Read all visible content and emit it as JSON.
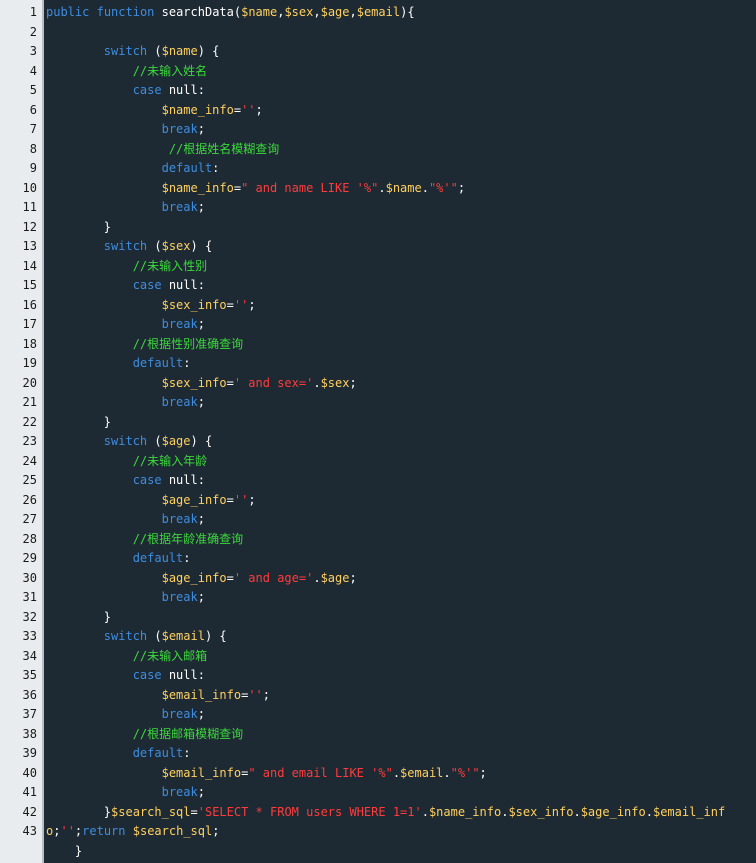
{
  "editor": {
    "line_numbers": [
      "1",
      "2",
      "3",
      "4",
      "5",
      "6",
      "7",
      "8",
      "9",
      "10",
      "11",
      "12",
      "13",
      "14",
      "15",
      "16",
      "17",
      "18",
      "19",
      "20",
      "21",
      "22",
      "23",
      "24",
      "25",
      "26",
      "27",
      "28",
      "29",
      "30",
      "31",
      "32",
      "33",
      "34",
      "35",
      "36",
      "37",
      "38",
      "39",
      "40",
      "41",
      "42",
      "43"
    ],
    "lines": [
      [
        {
          "k": "keyword",
          "t": "public"
        },
        {
          "k": "plain",
          "t": " "
        },
        {
          "k": "keyword",
          "t": "function"
        },
        {
          "k": "plain",
          "t": " searchData("
        },
        {
          "k": "var",
          "t": "$name"
        },
        {
          "k": "plain",
          "t": ","
        },
        {
          "k": "var",
          "t": "$sex"
        },
        {
          "k": "plain",
          "t": ","
        },
        {
          "k": "var",
          "t": "$age"
        },
        {
          "k": "plain",
          "t": ","
        },
        {
          "k": "var",
          "t": "$email"
        },
        {
          "k": "plain",
          "t": "){"
        }
      ],
      [],
      [
        {
          "k": "plain",
          "t": "        "
        },
        {
          "k": "keyword",
          "t": "switch"
        },
        {
          "k": "plain",
          "t": " ("
        },
        {
          "k": "var",
          "t": "$name"
        },
        {
          "k": "plain",
          "t": ") {"
        }
      ],
      [
        {
          "k": "plain",
          "t": "            "
        },
        {
          "k": "comment",
          "t": "//未输入姓名"
        }
      ],
      [
        {
          "k": "plain",
          "t": "            "
        },
        {
          "k": "keyword",
          "t": "case"
        },
        {
          "k": "plain",
          "t": " null:"
        }
      ],
      [
        {
          "k": "plain",
          "t": "                "
        },
        {
          "k": "var",
          "t": "$name_info"
        },
        {
          "k": "plain",
          "t": "="
        },
        {
          "k": "string",
          "t": "''"
        },
        {
          "k": "plain",
          "t": ";"
        }
      ],
      [
        {
          "k": "plain",
          "t": "                "
        },
        {
          "k": "keyword",
          "t": "break"
        },
        {
          "k": "plain",
          "t": ";"
        }
      ],
      [
        {
          "k": "plain",
          "t": "                 "
        },
        {
          "k": "comment",
          "t": "//根据姓名模糊查询"
        }
      ],
      [
        {
          "k": "plain",
          "t": "                "
        },
        {
          "k": "keyword",
          "t": "default"
        },
        {
          "k": "plain",
          "t": ":"
        }
      ],
      [
        {
          "k": "plain",
          "t": "                "
        },
        {
          "k": "var",
          "t": "$name_info"
        },
        {
          "k": "plain",
          "t": "="
        },
        {
          "k": "string",
          "t": "\" and name LIKE '%\""
        },
        {
          "k": "plain",
          "t": "."
        },
        {
          "k": "var",
          "t": "$name"
        },
        {
          "k": "plain",
          "t": "."
        },
        {
          "k": "string",
          "t": "\"%'\""
        },
        {
          "k": "plain",
          "t": ";"
        }
      ],
      [
        {
          "k": "plain",
          "t": "                "
        },
        {
          "k": "keyword",
          "t": "break"
        },
        {
          "k": "plain",
          "t": ";"
        }
      ],
      [
        {
          "k": "plain",
          "t": "        }"
        }
      ],
      [
        {
          "k": "plain",
          "t": "        "
        },
        {
          "k": "keyword",
          "t": "switch"
        },
        {
          "k": "plain",
          "t": " ("
        },
        {
          "k": "var",
          "t": "$sex"
        },
        {
          "k": "plain",
          "t": ") {"
        }
      ],
      [
        {
          "k": "plain",
          "t": "            "
        },
        {
          "k": "comment",
          "t": "//未输入性别"
        }
      ],
      [
        {
          "k": "plain",
          "t": "            "
        },
        {
          "k": "keyword",
          "t": "case"
        },
        {
          "k": "plain",
          "t": " null:"
        }
      ],
      [
        {
          "k": "plain",
          "t": "                "
        },
        {
          "k": "var",
          "t": "$sex_info"
        },
        {
          "k": "plain",
          "t": "="
        },
        {
          "k": "string",
          "t": "''"
        },
        {
          "k": "plain",
          "t": ";"
        }
      ],
      [
        {
          "k": "plain",
          "t": "                "
        },
        {
          "k": "keyword",
          "t": "break"
        },
        {
          "k": "plain",
          "t": ";"
        }
      ],
      [
        {
          "k": "plain",
          "t": "            "
        },
        {
          "k": "comment",
          "t": "//根据性别准确查询"
        }
      ],
      [
        {
          "k": "plain",
          "t": "            "
        },
        {
          "k": "keyword",
          "t": "default"
        },
        {
          "k": "plain",
          "t": ":"
        }
      ],
      [
        {
          "k": "plain",
          "t": "                "
        },
        {
          "k": "var",
          "t": "$sex_info"
        },
        {
          "k": "plain",
          "t": "="
        },
        {
          "k": "string",
          "t": "' and sex='"
        },
        {
          "k": "plain",
          "t": "."
        },
        {
          "k": "var",
          "t": "$sex"
        },
        {
          "k": "plain",
          "t": ";"
        }
      ],
      [
        {
          "k": "plain",
          "t": "                "
        },
        {
          "k": "keyword",
          "t": "break"
        },
        {
          "k": "plain",
          "t": ";"
        }
      ],
      [
        {
          "k": "plain",
          "t": "        }"
        }
      ],
      [
        {
          "k": "plain",
          "t": "        "
        },
        {
          "k": "keyword",
          "t": "switch"
        },
        {
          "k": "plain",
          "t": " ("
        },
        {
          "k": "var",
          "t": "$age"
        },
        {
          "k": "plain",
          "t": ") {"
        }
      ],
      [
        {
          "k": "plain",
          "t": "            "
        },
        {
          "k": "comment",
          "t": "//未输入年龄"
        }
      ],
      [
        {
          "k": "plain",
          "t": "            "
        },
        {
          "k": "keyword",
          "t": "case"
        },
        {
          "k": "plain",
          "t": " null:"
        }
      ],
      [
        {
          "k": "plain",
          "t": "                "
        },
        {
          "k": "var",
          "t": "$age_info"
        },
        {
          "k": "plain",
          "t": "="
        },
        {
          "k": "string",
          "t": "''"
        },
        {
          "k": "plain",
          "t": ";"
        }
      ],
      [
        {
          "k": "plain",
          "t": "                "
        },
        {
          "k": "keyword",
          "t": "break"
        },
        {
          "k": "plain",
          "t": ";"
        }
      ],
      [
        {
          "k": "plain",
          "t": "            "
        },
        {
          "k": "comment",
          "t": "//根据年龄准确查询"
        }
      ],
      [
        {
          "k": "plain",
          "t": "            "
        },
        {
          "k": "keyword",
          "t": "default"
        },
        {
          "k": "plain",
          "t": ":"
        }
      ],
      [
        {
          "k": "plain",
          "t": "                "
        },
        {
          "k": "var",
          "t": "$age_info"
        },
        {
          "k": "plain",
          "t": "="
        },
        {
          "k": "string",
          "t": "' and age='"
        },
        {
          "k": "plain",
          "t": "."
        },
        {
          "k": "var",
          "t": "$age"
        },
        {
          "k": "plain",
          "t": ";"
        }
      ],
      [
        {
          "k": "plain",
          "t": "                "
        },
        {
          "k": "keyword",
          "t": "break"
        },
        {
          "k": "plain",
          "t": ";"
        }
      ],
      [
        {
          "k": "plain",
          "t": "        }"
        }
      ],
      [
        {
          "k": "plain",
          "t": "        "
        },
        {
          "k": "keyword",
          "t": "switch"
        },
        {
          "k": "plain",
          "t": " ("
        },
        {
          "k": "var",
          "t": "$email"
        },
        {
          "k": "plain",
          "t": ") {"
        }
      ],
      [
        {
          "k": "plain",
          "t": "            "
        },
        {
          "k": "comment",
          "t": "//未输入邮箱"
        }
      ],
      [
        {
          "k": "plain",
          "t": "            "
        },
        {
          "k": "keyword",
          "t": "case"
        },
        {
          "k": "plain",
          "t": " null:"
        }
      ],
      [
        {
          "k": "plain",
          "t": "                "
        },
        {
          "k": "var",
          "t": "$email_info"
        },
        {
          "k": "plain",
          "t": "="
        },
        {
          "k": "string",
          "t": "''"
        },
        {
          "k": "plain",
          "t": ";"
        }
      ],
      [
        {
          "k": "plain",
          "t": "                "
        },
        {
          "k": "keyword",
          "t": "break"
        },
        {
          "k": "plain",
          "t": ";"
        }
      ],
      [
        {
          "k": "plain",
          "t": "            "
        },
        {
          "k": "comment",
          "t": "//根据邮箱模糊查询"
        }
      ],
      [
        {
          "k": "plain",
          "t": "            "
        },
        {
          "k": "keyword",
          "t": "default"
        },
        {
          "k": "plain",
          "t": ":"
        }
      ],
      [
        {
          "k": "plain",
          "t": "                "
        },
        {
          "k": "var",
          "t": "$email_info"
        },
        {
          "k": "plain",
          "t": "="
        },
        {
          "k": "string",
          "t": "\" and email LIKE '%\""
        },
        {
          "k": "plain",
          "t": "."
        },
        {
          "k": "var",
          "t": "$email"
        },
        {
          "k": "plain",
          "t": "."
        },
        {
          "k": "string",
          "t": "\"%'\""
        },
        {
          "k": "plain",
          "t": ";"
        }
      ],
      [
        {
          "k": "plain",
          "t": "                "
        },
        {
          "k": "keyword",
          "t": "break"
        },
        {
          "k": "plain",
          "t": ";"
        }
      ],
      [
        {
          "k": "plain",
          "t": "        }"
        },
        {
          "k": "var",
          "t": "$search_sql"
        },
        {
          "k": "plain",
          "t": "="
        },
        {
          "k": "string",
          "t": "'SELECT * FROM users WHERE 1=1'"
        },
        {
          "k": "plain",
          "t": "."
        },
        {
          "k": "var",
          "t": "$name_info"
        },
        {
          "k": "plain",
          "t": "."
        },
        {
          "k": "var",
          "t": "$sex_info"
        },
        {
          "k": "plain",
          "t": "."
        },
        {
          "k": "var",
          "t": "$age_info"
        },
        {
          "k": "plain",
          "t": "."
        },
        {
          "k": "var",
          "t": "$email_inf"
        }
      ],
      [
        {
          "k": "var",
          "t": "o"
        },
        {
          "k": "plain",
          "t": ";"
        },
        {
          "k": "string",
          "t": "''"
        },
        {
          "k": "plain",
          "t": ";"
        },
        {
          "k": "keyword",
          "t": "return"
        },
        {
          "k": "plain",
          "t": " "
        },
        {
          "k": "var",
          "t": "$search_sql"
        },
        {
          "k": "plain",
          "t": ";"
        }
      ],
      [
        {
          "k": "plain",
          "t": "    }"
        }
      ]
    ]
  },
  "colors": {
    "background": "#1e2a33",
    "gutter": "#e9ecee",
    "keyword": "#3d8de0",
    "variable": "#ffd060",
    "string": "#ff3b3b",
    "comment": "#3cd83c",
    "plain": "#ffffff"
  }
}
